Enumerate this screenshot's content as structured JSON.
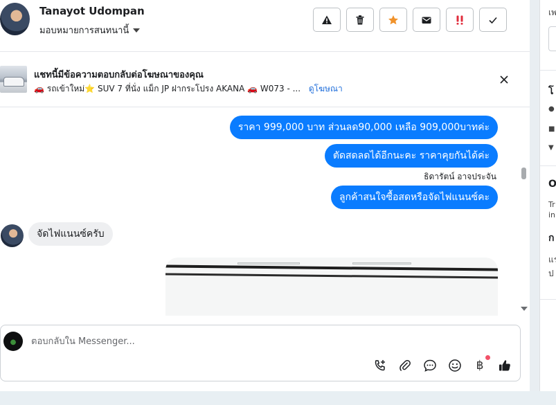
{
  "header": {
    "contact_name": "Tanayot Udompan",
    "assign_label": "มอบหมายการสนทนานี้"
  },
  "actions": [
    {
      "name": "spam-report-button",
      "icon": "warning-icon"
    },
    {
      "name": "delete-button",
      "icon": "trash-icon"
    },
    {
      "name": "follow-up-button",
      "icon": "star-icon",
      "color": "#f0922b"
    },
    {
      "name": "mark-unread-button",
      "icon": "envelope-icon"
    },
    {
      "name": "priority-button",
      "icon": "exclamation-icon",
      "color": "#e02d3c"
    },
    {
      "name": "mark-done-button",
      "icon": "check-icon"
    }
  ],
  "ad": {
    "title": "แชทนี้มีข้อความตอบกลับต่อโฆษณาของคุณ",
    "description": "🚗 รถเข้าใหม่⭐ SUV 7 ที่นั่ง แม็ก JP ฝากระโปรง AKANA 🚗 W073 - ...",
    "link": "ดูโฆษณา"
  },
  "messages": [
    {
      "from": "page",
      "text": "ราคา 999,000 บาท ส่วนลด90,000 เหลือ 909,000บาทค่ะ"
    },
    {
      "from": "page",
      "text": "ตัดสดลดได้อีกนะคะ ราคาคุยกันได้ค่ะ"
    },
    {
      "from": "page",
      "sender": "ธิดารัตน์ อาจประจัน",
      "text": "ลูกค้าสนใจซื้อสดหรือจัดไฟแนนซ์คะ"
    },
    {
      "from": "customer",
      "text": "จัดไฟแนนซ์ครับ"
    }
  ],
  "composer": {
    "placeholder": "ตอบกลับใน Messenger..."
  },
  "colors": {
    "outgoing_bubble": "#0a7cff",
    "incoming_bubble": "#eeeff1",
    "link": "#216fdb"
  },
  "right_panel": {
    "fragment_top": "เพ",
    "fragment_bold_1": "โ",
    "fragment_bold_2": "O",
    "fragment_3": "Tr",
    "fragment_4": "in",
    "fragment_bold_5": "ก",
    "fragment_6": "แร",
    "fragment_7": "ป"
  }
}
